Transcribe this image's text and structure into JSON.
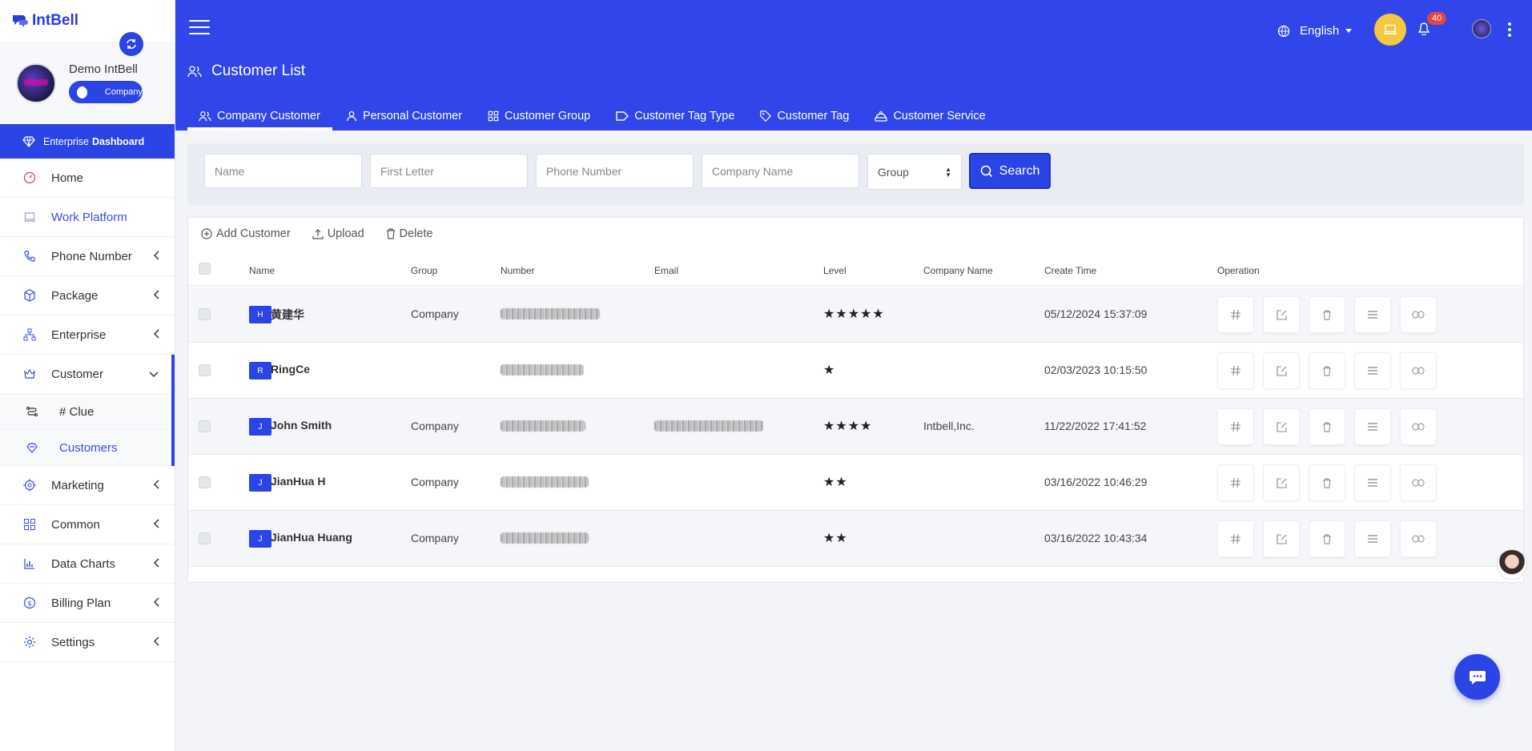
{
  "brand": {
    "name": "IntBell"
  },
  "profile": {
    "name": "Demo IntBell",
    "role": "Company"
  },
  "enterprise_dashboard": {
    "prefix": "Enterprise",
    "bold": "Dashboard"
  },
  "sidebar": {
    "items": [
      {
        "label": "Home",
        "icon": "gauge-icon"
      },
      {
        "label": "Work Platform",
        "icon": "laptop-icon"
      },
      {
        "label": "Phone Number",
        "icon": "phone-icon"
      },
      {
        "label": "Package",
        "icon": "box-icon"
      },
      {
        "label": "Enterprise",
        "icon": "sitemap-icon"
      },
      {
        "label": "Customer",
        "icon": "crown-icon"
      },
      {
        "label": "Marketing",
        "icon": "target-icon"
      },
      {
        "label": "Common",
        "icon": "grid-icon"
      },
      {
        "label": "Data Charts",
        "icon": "bar-chart-icon"
      },
      {
        "label": "Billing Plan",
        "icon": "dollar-icon"
      },
      {
        "label": "Settings",
        "icon": "gear-icon"
      }
    ],
    "customer_sub": [
      {
        "label": "# Clue"
      },
      {
        "label": "Customers"
      }
    ]
  },
  "header": {
    "language": "English",
    "notifications": "40",
    "page_title": "Customer List"
  },
  "tabs": [
    {
      "label": "Company Customer"
    },
    {
      "label": "Personal Customer"
    },
    {
      "label": "Customer Group"
    },
    {
      "label": "Customer Tag Type"
    },
    {
      "label": "Customer Tag"
    },
    {
      "label": "Customer Service"
    }
  ],
  "search": {
    "name_placeholder": "Name",
    "first_letter_placeholder": "First Letter",
    "phone_placeholder": "Phone Number",
    "company_placeholder": "Company Name",
    "group_selected": "Group",
    "button": "Search"
  },
  "toolbar": {
    "add": "Add Customer",
    "upload": "Upload",
    "delete": "Delete"
  },
  "table": {
    "columns": [
      "Name",
      "Group",
      "Number",
      "Email",
      "Level",
      "Company Name",
      "Create Time",
      "Operation"
    ],
    "rows": [
      {
        "initial": "H",
        "name": "黄建华",
        "group": "Company",
        "email_redacted": false,
        "level": "★★★★★",
        "company": "",
        "created": "05/12/2024 15:37:09"
      },
      {
        "initial": "R",
        "name": "RingCe",
        "group": "",
        "email_redacted": false,
        "level": "★",
        "company": "",
        "created": "02/03/2023 10:15:50"
      },
      {
        "initial": "J",
        "name": "John Smith",
        "group": "Company",
        "email_redacted": true,
        "level": "★★★★",
        "company": "Intbell,Inc.",
        "created": "11/22/2022 17:41:52"
      },
      {
        "initial": "J",
        "name": "JianHua H",
        "group": "Company",
        "email_redacted": false,
        "level": "★★",
        "company": "",
        "created": "03/16/2022 10:46:29"
      },
      {
        "initial": "J",
        "name": "JianHua Huang",
        "group": "Company",
        "email_redacted": false,
        "level": "★★",
        "company": "",
        "created": "03/16/2022 10:43:34"
      }
    ]
  },
  "colors": {
    "primary": "#3046ea",
    "accent_yellow": "#f5c842",
    "badge_red": "#e24747"
  }
}
